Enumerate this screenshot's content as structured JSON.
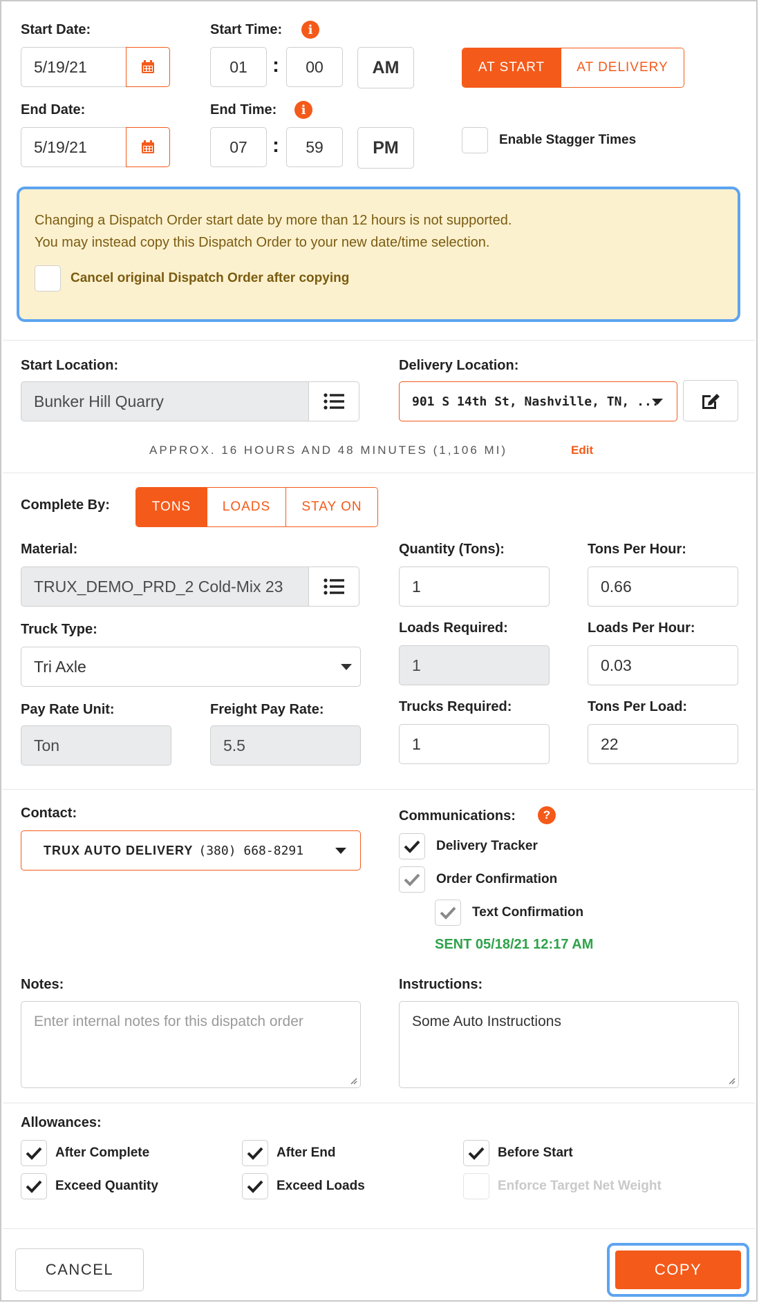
{
  "schedule": {
    "start_date_label": "Start Date:",
    "start_date_value": "5/19/21",
    "start_time_label": "Start Time:",
    "start_hour": "01",
    "start_minute": "00",
    "start_ampm": "AM",
    "end_date_label": "End Date:",
    "end_date_value": "5/19/21",
    "end_time_label": "End Time:",
    "end_hour": "07",
    "end_minute": "59",
    "end_ampm": "PM",
    "time_colon": ":",
    "timing_options": [
      {
        "label": "AT START",
        "active": true
      },
      {
        "label": "AT DELIVERY",
        "active": false
      }
    ],
    "stagger_label": "Enable Stagger Times"
  },
  "warning": {
    "line1": "Changing a Dispatch Order start date by more than 12 hours is not supported.",
    "line2": "You may instead copy this Dispatch Order to your new date/time selection.",
    "cancel_original_label": "Cancel original Dispatch Order after copying"
  },
  "locations": {
    "start_label": "Start Location:",
    "start_value": "Bunker Hill Quarry",
    "delivery_label": "Delivery Location:",
    "delivery_value": "901 S 14th St, Nashville, TN, ...",
    "approx_text": "APPROX. 16 HOURS AND 48 MINUTES (1,106 MI)",
    "edit_link": "Edit"
  },
  "job": {
    "complete_by_label": "Complete By:",
    "complete_by_options": [
      {
        "label": "TONS",
        "active": true
      },
      {
        "label": "LOADS",
        "active": false
      },
      {
        "label": "STAY ON",
        "active": false
      }
    ],
    "material_label": "Material:",
    "material_value": "TRUX_DEMO_PRD_2 Cold-Mix 23",
    "quantity_label": "Quantity (Tons):",
    "quantity_value": "1",
    "tons_per_hour_label": "Tons Per Hour:",
    "tons_per_hour_value": "0.66",
    "truck_type_label": "Truck Type:",
    "truck_type_value": "Tri Axle",
    "loads_required_label": "Loads Required:",
    "loads_required_value": "1",
    "loads_per_hour_label": "Loads Per Hour:",
    "loads_per_hour_value": "0.03",
    "pay_rate_unit_label": "Pay Rate Unit:",
    "pay_rate_unit_value": "Ton",
    "freight_pay_rate_label": "Freight Pay Rate:",
    "freight_pay_rate_value": "5.5",
    "trucks_required_label": "Trucks Required:",
    "trucks_required_value": "1",
    "tons_per_load_label": "Tons Per Load:",
    "tons_per_load_value": "22"
  },
  "contact": {
    "label": "Contact:",
    "name": "TRUX AUTO DELIVERY",
    "phone": "(380) 668-8291"
  },
  "communications": {
    "label": "Communications:",
    "help_glyph": "?",
    "delivery_tracker": "Delivery Tracker",
    "order_confirmation": "Order Confirmation",
    "text_confirmation": "Text Confirmation",
    "sent_status": "SENT 05/18/21 12:17 AM"
  },
  "notes": {
    "notes_label": "Notes:",
    "notes_placeholder": "Enter internal notes for this dispatch order",
    "instructions_label": "Instructions:",
    "instructions_value": "Some Auto Instructions"
  },
  "allowances": {
    "label": "Allowances:",
    "after_complete": "After Complete",
    "after_end": "After End",
    "before_start": "Before Start",
    "exceed_quantity": "Exceed Quantity",
    "exceed_loads": "Exceed Loads",
    "enforce_target": "Enforce Target Net Weight"
  },
  "footer": {
    "cancel_label": "CANCEL",
    "copy_label": "COPY"
  },
  "colors": {
    "accent": "#f45a1a",
    "focus_ring": "#5da4f0",
    "warning_bg": "#fcf1cf",
    "success": "#2fa24a"
  }
}
